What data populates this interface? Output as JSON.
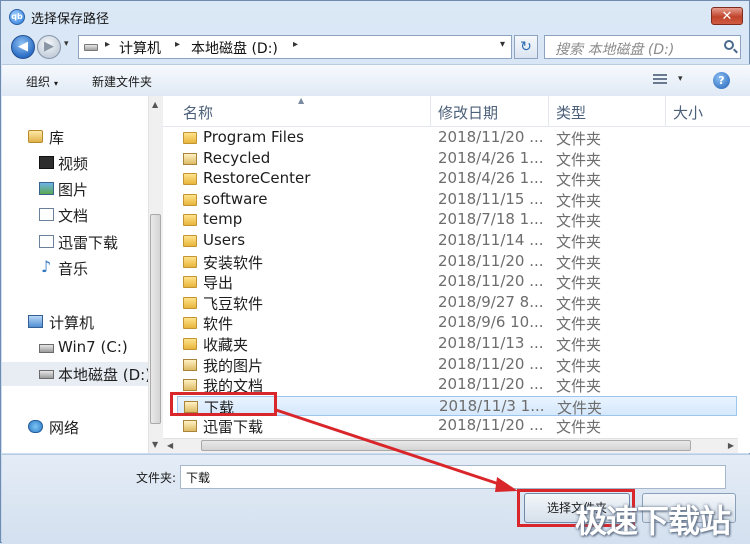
{
  "window": {
    "title": "选择保存路径",
    "close_glyph": "✕",
    "app_icon_text": "qb"
  },
  "nav": {
    "back_glyph": "◀",
    "forward_glyph": "▶",
    "refresh_glyph": "↻"
  },
  "address": {
    "crumbs": [
      "计算机",
      "本地磁盘 (D:)"
    ],
    "sep": "▸",
    "dropdown": "▾"
  },
  "search": {
    "placeholder": "搜索 本地磁盘 (D:)"
  },
  "toolbar": {
    "organize": "组织",
    "new_folder": "新建文件夹",
    "caret": "▾",
    "help": "?"
  },
  "sidebar": {
    "items": [
      {
        "label": "库",
        "icon": "library-icon"
      },
      {
        "label": "视频",
        "icon": "video-icon"
      },
      {
        "label": "图片",
        "icon": "pictures-icon"
      },
      {
        "label": "文档",
        "icon": "documents-icon"
      },
      {
        "label": "迅雷下载",
        "icon": "download-folder-icon"
      },
      {
        "label": "音乐",
        "icon": "music-icon"
      },
      {
        "label": "计算机",
        "icon": "computer-icon"
      },
      {
        "label": "Win7 (C:)",
        "icon": "drive-icon"
      },
      {
        "label": "本地磁盘 (D:)",
        "icon": "drive-icon",
        "selected": true
      },
      {
        "label": "网络",
        "icon": "network-icon"
      }
    ]
  },
  "columns": {
    "name": "名称",
    "modified": "修改日期",
    "type": "类型",
    "size": "大小"
  },
  "files": [
    {
      "name": "Program Files",
      "date": "2018/11/20 ...",
      "type": "文件夹"
    },
    {
      "name": "Recycled",
      "date": "2018/4/26 1...",
      "type": "文件夹"
    },
    {
      "name": "RestoreCenter",
      "date": "2018/4/26 1...",
      "type": "文件夹"
    },
    {
      "name": "software",
      "date": "2018/11/15 ...",
      "type": "文件夹"
    },
    {
      "name": "temp",
      "date": "2018/7/18 1...",
      "type": "文件夹"
    },
    {
      "name": "Users",
      "date": "2018/11/14 ...",
      "type": "文件夹"
    },
    {
      "name": "安装软件",
      "date": "2018/11/20 ...",
      "type": "文件夹"
    },
    {
      "name": "导出",
      "date": "2018/11/20 ...",
      "type": "文件夹"
    },
    {
      "name": "飞豆软件",
      "date": "2018/9/27 8...",
      "type": "文件夹"
    },
    {
      "name": "软件",
      "date": "2018/9/6 10...",
      "type": "文件夹"
    },
    {
      "name": "收藏夹",
      "date": "2018/11/13 ...",
      "type": "文件夹"
    },
    {
      "name": "我的图片",
      "date": "2018/11/20 ...",
      "type": "文件夹"
    },
    {
      "name": "我的文档",
      "date": "2018/11/20 ...",
      "type": "文件夹"
    },
    {
      "name": "下载",
      "date": "2018/11/3 1...",
      "type": "文件夹",
      "selected": true
    },
    {
      "name": "迅雷下载",
      "date": "2018/11/20 ...",
      "type": "文件夹"
    }
  ],
  "footer": {
    "folder_label": "文件夹:",
    "folder_value": "下载",
    "select_button": "选择文件夹",
    "cancel_button": ""
  },
  "watermark": "极速下载站",
  "colors": {
    "highlight": "#d9262a",
    "selection": "#d5e8fc"
  }
}
